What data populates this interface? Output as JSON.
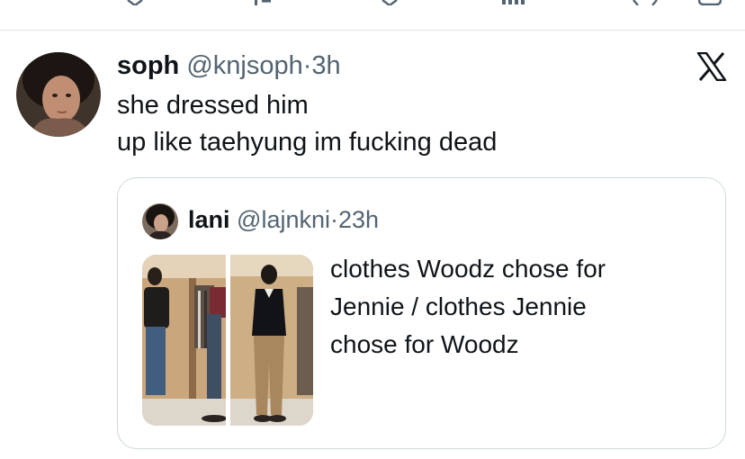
{
  "post": {
    "author_name": "soph",
    "author_handle": "@knjsoph",
    "separator": "·",
    "time": "3h",
    "text_lines": [
      "she dressed him",
      "up like taehyung im fucking dead"
    ]
  },
  "quoted_post": {
    "author_name": "lani",
    "author_handle": "@lajnkni",
    "separator": "·",
    "time": "23h",
    "text_lines": [
      "clothes Woodz chose for",
      "Jennie / clothes Jennie",
      "chose for Woodz"
    ]
  },
  "icons": {
    "top_row": [
      "retweet-icon",
      "stats-icon",
      "download-icon",
      "views-icon",
      "close-icon",
      "bookmark-icon"
    ],
    "logo": "x-logo-icon"
  },
  "colors": {
    "text_primary": "#0f1419",
    "text_secondary": "#536471",
    "border": "#cfd9de",
    "divider": "#e1e6ea"
  }
}
